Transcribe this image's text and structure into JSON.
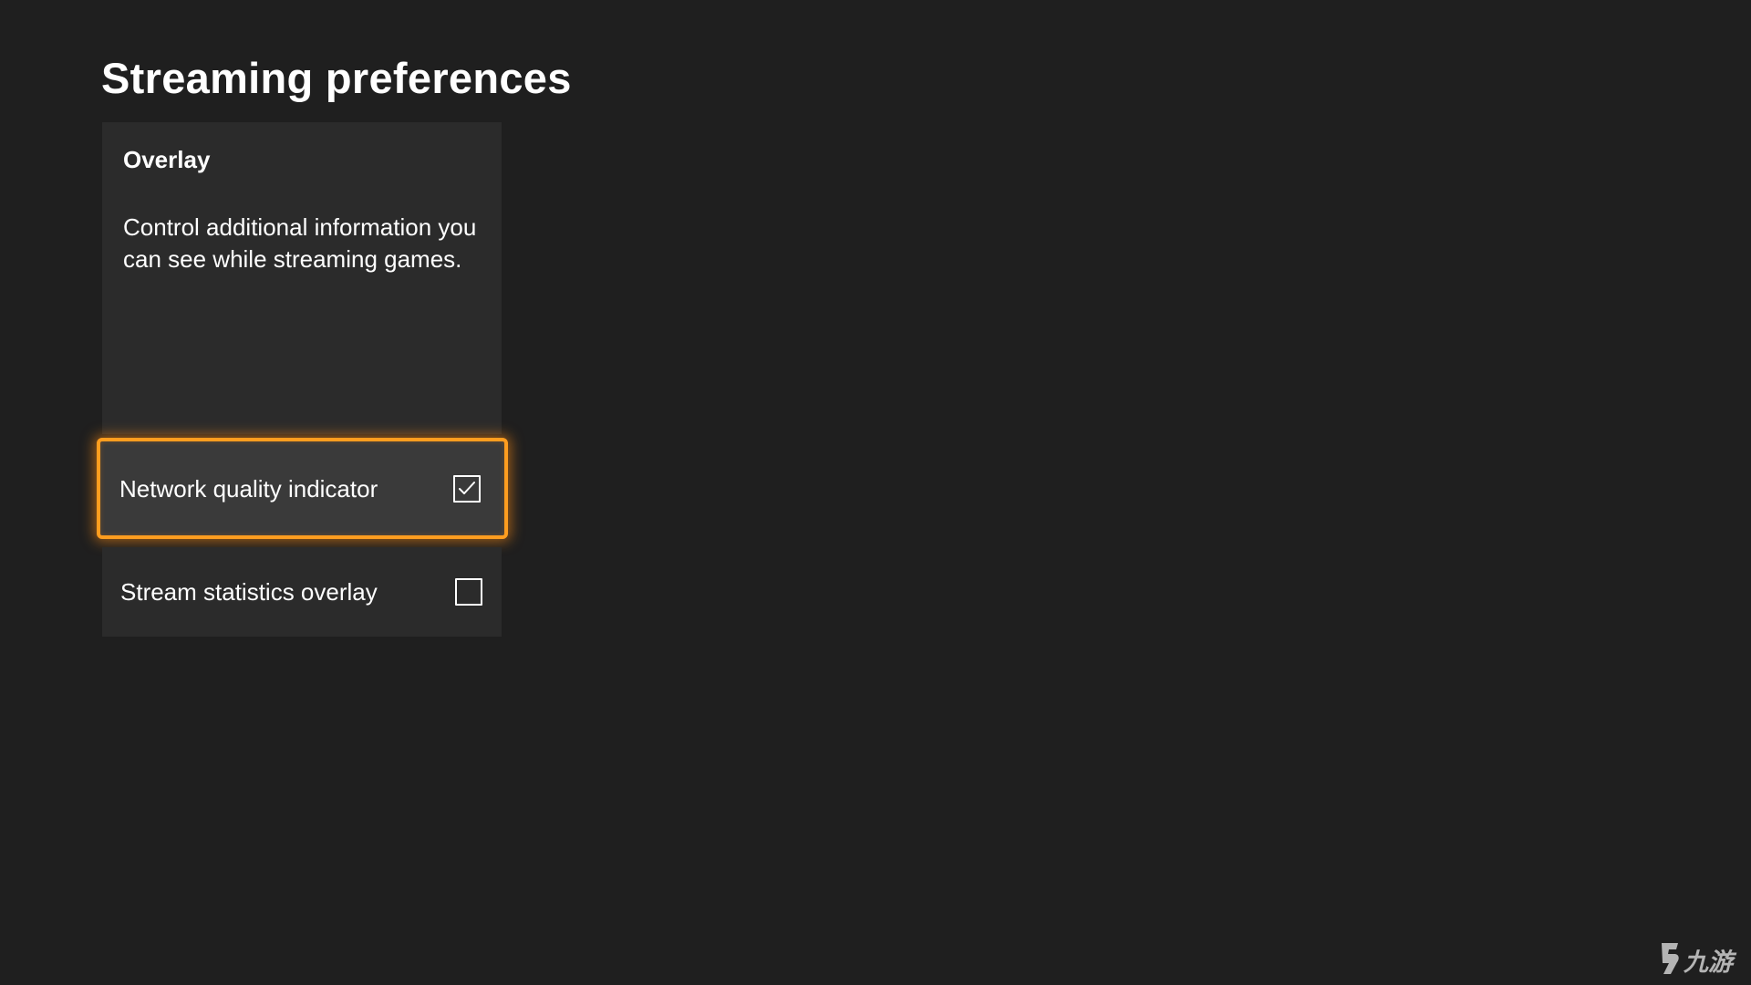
{
  "page": {
    "title": "Streaming preferences"
  },
  "panel": {
    "heading": "Overlay",
    "description": "Control additional information you can see while streaming games."
  },
  "options": [
    {
      "label": "Network quality indicator",
      "checked": true,
      "focused": true
    },
    {
      "label": "Stream statistics overlay",
      "checked": false,
      "focused": false
    }
  ],
  "watermark": {
    "text": "九游"
  },
  "colors": {
    "background": "#1f1f1f",
    "panel": "#2b2b2b",
    "focus_fill": "#3a3a3a",
    "focus_accent": "#ff9d1f"
  }
}
